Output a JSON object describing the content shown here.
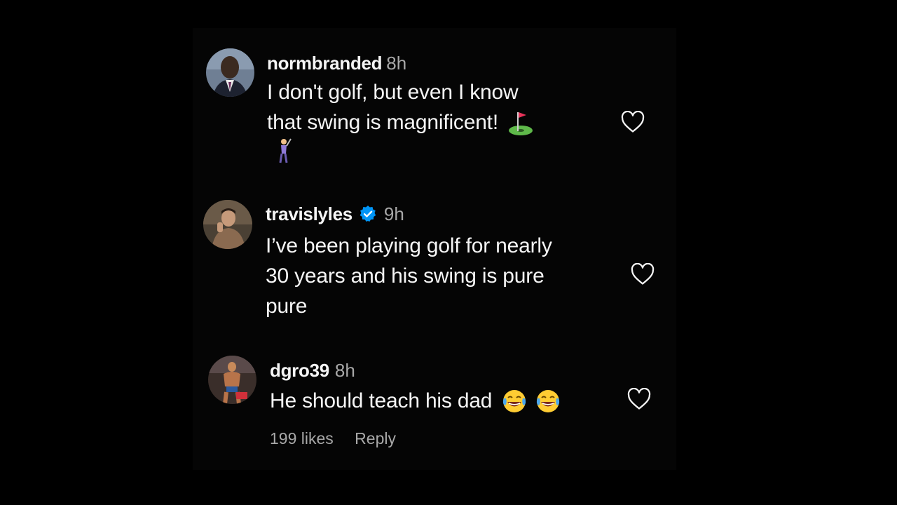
{
  "comments": [
    {
      "username": "normbranded",
      "time": "8h",
      "text_lines": [
        "I don't golf, but even I know",
        "that swing is magnificent!"
      ],
      "emojis": [
        "golf-flag-emoji",
        "person-golfing-emoji"
      ],
      "verified": false
    },
    {
      "username": "travislyles",
      "time": "9h",
      "text_lines": [
        "I’ve been playing golf for nearly",
        "30 years and his swing is pure",
        "pure"
      ],
      "verified": true
    },
    {
      "username": "dgro39",
      "time": "8h",
      "text_lines": [
        "He should teach his dad"
      ],
      "emojis": [
        "laughing-tears-emoji",
        "laughing-tears-emoji"
      ],
      "likes": "199 likes",
      "reply": "Reply",
      "verified": false
    }
  ],
  "colors": {
    "background": "#000000",
    "text": "#f5f5f5",
    "muted": "#a8a8a8",
    "verified": "#0095f6"
  }
}
